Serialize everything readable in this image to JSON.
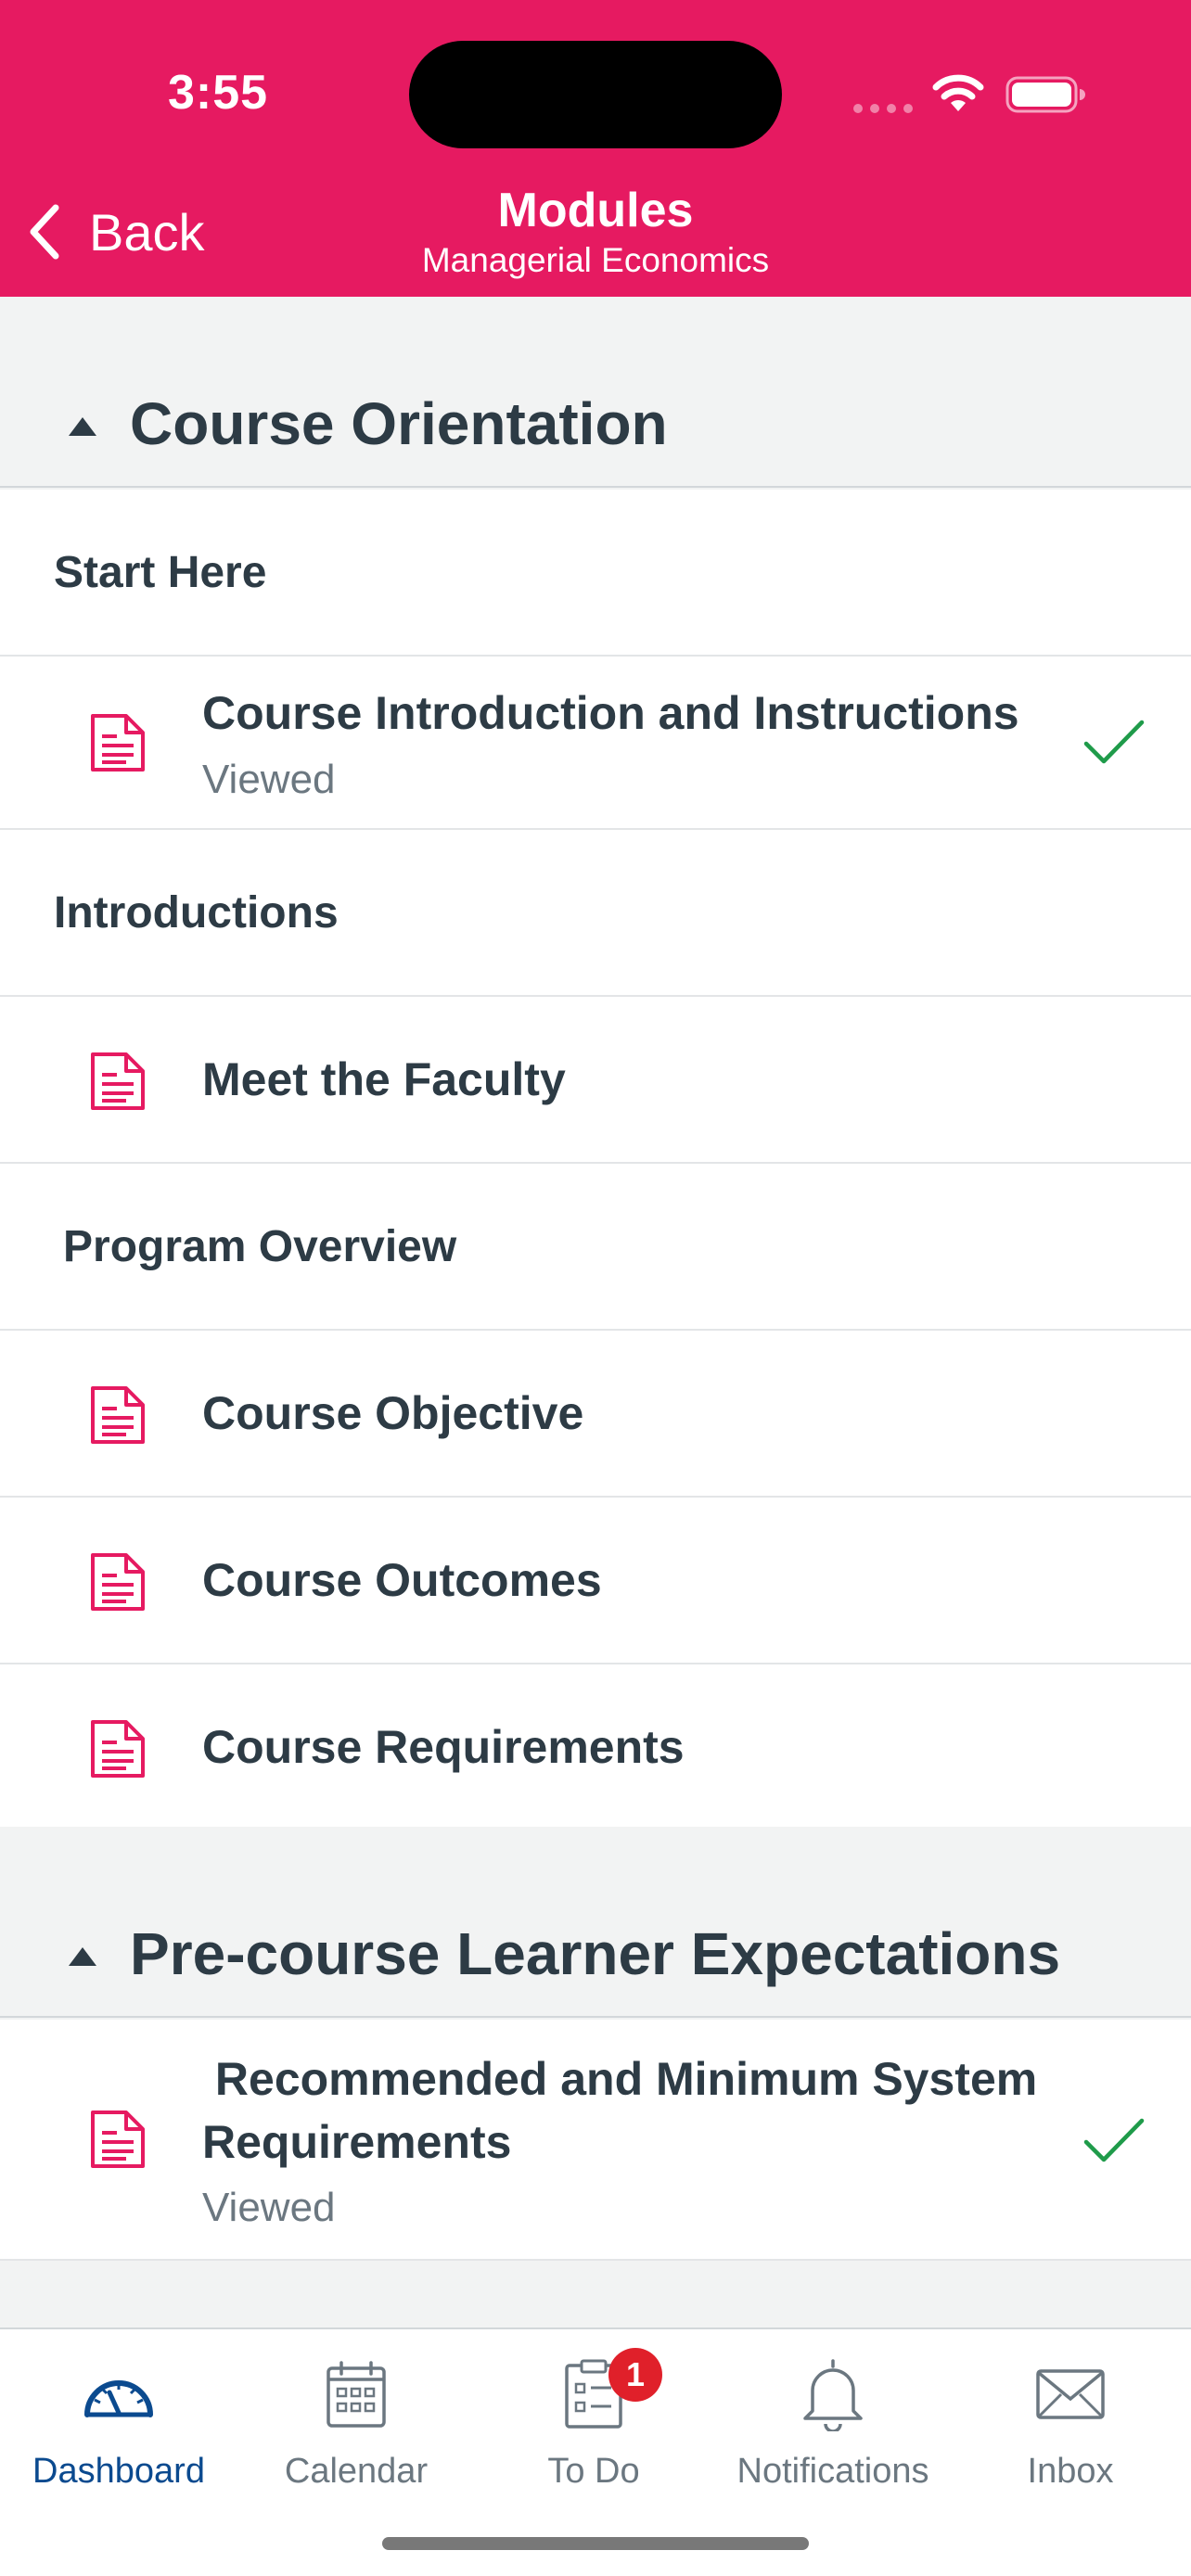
{
  "status_bar": {
    "time": "3:55"
  },
  "nav": {
    "back_label": "Back",
    "title": "Modules",
    "subtitle": "Managerial Economics"
  },
  "modules": [
    {
      "title": "Course Orientation",
      "rows": [
        {
          "type": "subheader",
          "label": "Start Here"
        },
        {
          "type": "item",
          "label": "Course Introduction and Instructions",
          "status": "Viewed",
          "completed": true
        },
        {
          "type": "subheader",
          "label": "Introductions"
        },
        {
          "type": "item",
          "label": "Meet the Faculty"
        },
        {
          "type": "subheader",
          "label": "Program Overview"
        },
        {
          "type": "item",
          "label": "Course Objective"
        },
        {
          "type": "item",
          "label": "Course Outcomes"
        },
        {
          "type": "item",
          "label": "Course Requirements"
        }
      ]
    },
    {
      "title": "Pre-course Learner Expectations",
      "rows": [
        {
          "type": "item",
          "label": " Recommended and Minimum System Requirements",
          "status": "Viewed",
          "completed": true
        }
      ]
    }
  ],
  "tabs": [
    {
      "label": "Dashboard",
      "icon": "dashboard-gauge-icon",
      "active": true
    },
    {
      "label": "Calendar",
      "icon": "calendar-icon"
    },
    {
      "label": "To Do",
      "icon": "todo-clipboard-icon",
      "badge": "1"
    },
    {
      "label": "Notifications",
      "icon": "bell-icon"
    },
    {
      "label": "Inbox",
      "icon": "envelope-icon"
    }
  ],
  "colors": {
    "brand": "#e61a61",
    "text": "#2d3b45",
    "muted": "#6b7780",
    "success": "#1f9b4a",
    "active_tab": "#0b4a8f",
    "badge": "#e0202a"
  }
}
